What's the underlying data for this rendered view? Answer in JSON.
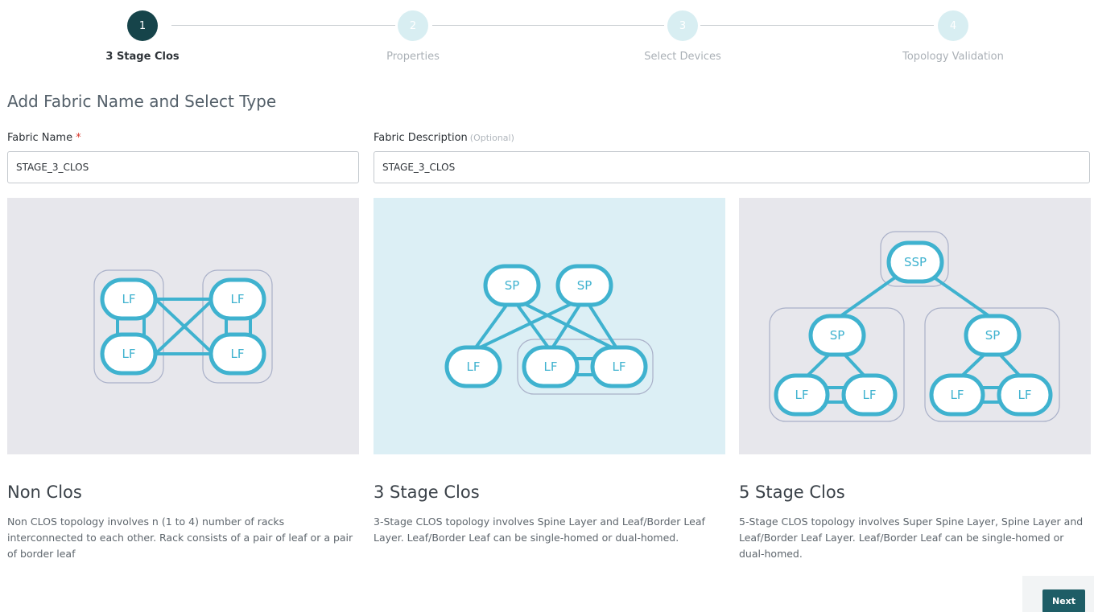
{
  "stepper": {
    "steps": [
      {
        "number": "1",
        "label": "3 Stage Clos",
        "state": "active"
      },
      {
        "number": "2",
        "label": "Properties",
        "state": "inactive"
      },
      {
        "number": "3",
        "label": "Select Devices",
        "state": "inactive"
      },
      {
        "number": "4",
        "label": "Topology Validation",
        "state": "inactive"
      }
    ]
  },
  "form": {
    "section_title": "Add Fabric Name and Select Type",
    "fabric_name": {
      "label": "Fabric Name",
      "required_marker": "*",
      "value": "STAGE_3_CLOS"
    },
    "fabric_description": {
      "label": "Fabric Description",
      "optional_hint": "(Optional)",
      "value": "STAGE_3_CLOS"
    }
  },
  "topology_cards": [
    {
      "title": "Non Clos",
      "description": "Non CLOS topology involves n (1 to 4) number of racks interconnected to each other. Rack consists of a pair of leaf or a pair of border leaf",
      "selected": false,
      "nodes": [
        "LF",
        "LF",
        "LF",
        "LF"
      ]
    },
    {
      "title": "3 Stage Clos",
      "description": "3-Stage CLOS topology involves Spine Layer and Leaf/Border Leaf Layer. Leaf/Border Leaf can be single-homed or dual-homed.",
      "selected": true,
      "nodes": [
        "SP",
        "SP",
        "LF",
        "LF",
        "LF"
      ]
    },
    {
      "title": "5 Stage Clos",
      "description": "5-Stage CLOS topology involves Super Spine Layer, Spine Layer and Leaf/Border Leaf Layer. Leaf/Border Leaf can be single-homed or dual-homed.",
      "selected": false,
      "nodes": [
        "SSP",
        "SP",
        "SP",
        "LF",
        "LF",
        "LF",
        "LF"
      ]
    }
  ],
  "actions": {
    "next_label": "Next"
  },
  "colors": {
    "accent": "#1e5d66",
    "step_active": "#16444a",
    "diagram": "#3fb2cf",
    "selected_card_bg": "#dceff5"
  }
}
